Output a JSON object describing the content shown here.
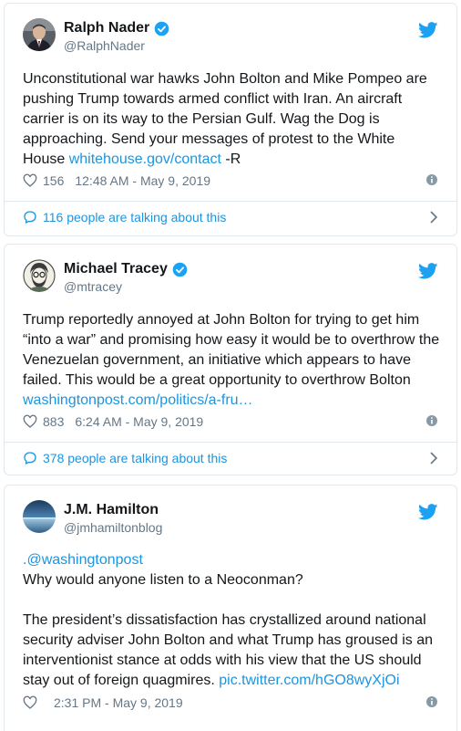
{
  "tweets": [
    {
      "display_name": "Ralph Nader",
      "handle": "@RalphNader",
      "verified": true,
      "text": "Unconstitutional war hawks John Bolton and Mike Pompeo are pushing Trump towards armed conflict with Iran. An aircraft carrier is on its way to the Persian Gulf. Wag the Dog is approaching. Send your messages of protest to the White House ",
      "link": "whitehouse.gov/contact",
      "text_suffix": " -R",
      "likes": "156",
      "timestamp": "12:48 AM - May 9, 2019",
      "talking": "116 people are talking about this"
    },
    {
      "display_name": "Michael Tracey",
      "handle": "@mtracey",
      "verified": true,
      "text": "Trump reportedly annoyed at John Bolton for trying to get him “into a war” and promising how easy it would be to overthrow the Venezuelan government, an initiative which appears to have failed. This would be a great opportunity to overthrow Bolton ",
      "link": "washingtonpost.com/politics/a-fru…",
      "text_suffix": "",
      "likes": "883",
      "timestamp": "6:24 AM - May 9, 2019",
      "talking": "378 people are talking about this"
    },
    {
      "display_name": "J.M. Hamilton",
      "handle": "@jmhamiltonblog",
      "verified": false,
      "mention_prefix": ".",
      "mention": "@washingtonpost",
      "text": "Why would anyone listen to a Neoconman?\n\nThe president’s dissatisfaction has crystallized around national security adviser John Bolton and what Trump has groused is an interventionist stance at odds with his view that the US should stay out of foreign quagmires. ",
      "link": "pic.twitter.com/hGO8wyXjOi",
      "likes": "",
      "timestamp": "2:31 PM - May 9, 2019"
    }
  ],
  "icons": {
    "verified": "verified-badge-icon",
    "bird": "twitter-bird-icon",
    "heart": "heart-icon",
    "info": "info-icon",
    "bubble": "speech-bubble-icon",
    "chevron": "chevron-right-icon"
  },
  "colors": {
    "link": "#1b95e0",
    "twitter_blue": "#1da1f2",
    "secondary_text": "#657786",
    "border": "#e1e8ed"
  }
}
